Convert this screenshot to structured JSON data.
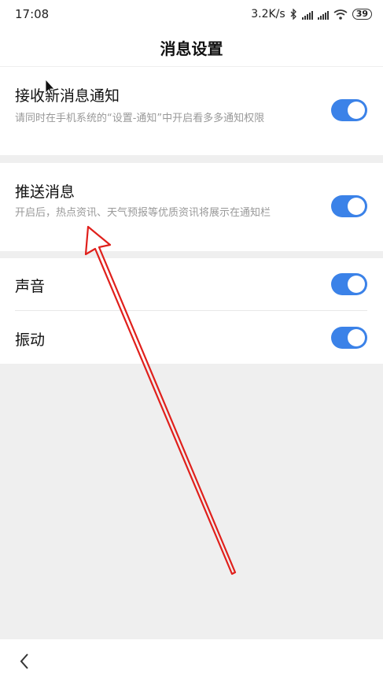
{
  "status_bar": {
    "time": "17:08",
    "speed": "3.2K/s",
    "battery": "39"
  },
  "header": {
    "title": "消息设置"
  },
  "settings": [
    {
      "title": "接收新消息通知",
      "desc": "请同时在手机系统的“设置-通知”中开启看多多通知权限",
      "enabled": true
    },
    {
      "title": "推送消息",
      "desc": "开启后，热点资讯、天气预报等优质资讯将展示在通知栏",
      "enabled": true
    },
    {
      "title": "声音",
      "enabled": true
    },
    {
      "title": "振动",
      "enabled": true
    }
  ],
  "colors": {
    "toggle_on": "#3b82e8",
    "annotation_arrow": "#e0201c"
  },
  "icons": {
    "back": "chevron-left-icon",
    "bluetooth": "bluetooth-icon",
    "signal": "signal-icon",
    "wifi": "wifi-icon",
    "battery": "battery-icon"
  }
}
